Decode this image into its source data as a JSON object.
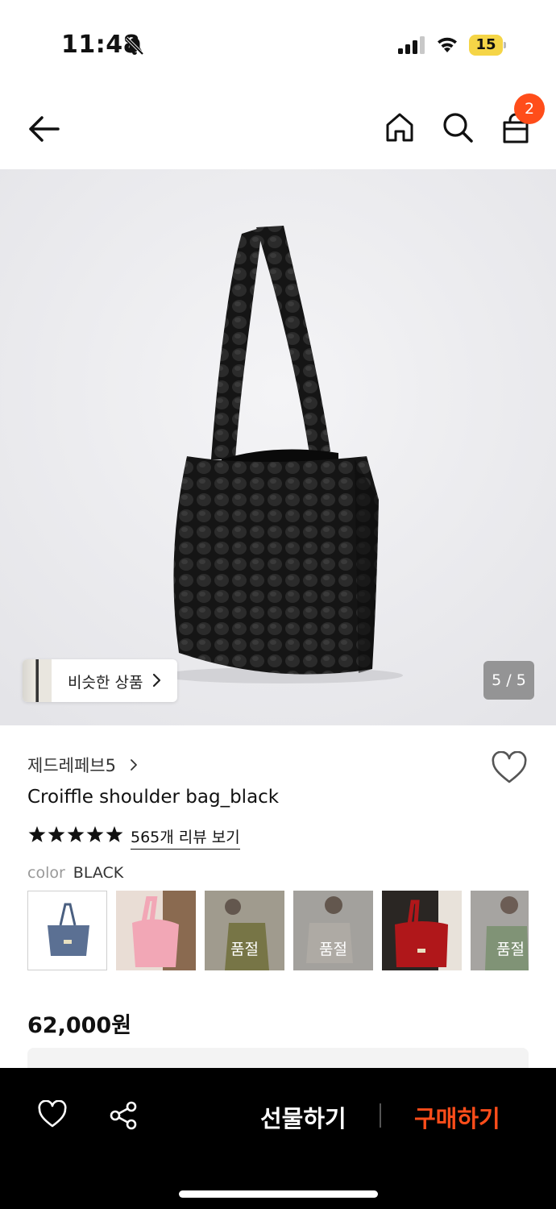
{
  "status_bar": {
    "time": "11:48",
    "battery": "15"
  },
  "header": {
    "cart_count": "2"
  },
  "gallery": {
    "similar_label": "비슷한 상품",
    "counter": "5 / 5"
  },
  "product": {
    "brand": "제드레페브5",
    "title": "Croiffle shoulder bag_black",
    "rating_stars": 5,
    "review_link": "565개 리뷰 보기",
    "color_key": "color",
    "color_value": "BLACK",
    "swatches": [
      {
        "name": "blue"
      },
      {
        "name": "pink"
      },
      {
        "name": "olive",
        "status": "품절"
      },
      {
        "name": "cream",
        "status": "품절"
      },
      {
        "name": "red"
      },
      {
        "name": "green",
        "status": "품절"
      }
    ],
    "price": "62,000원"
  },
  "bottom_bar": {
    "gift_label": "선물하기",
    "buy_label": "구매하기"
  },
  "colors": {
    "accent": "#ff4d1a",
    "bottom_bar": "#000000",
    "battery": "#f5d547"
  }
}
